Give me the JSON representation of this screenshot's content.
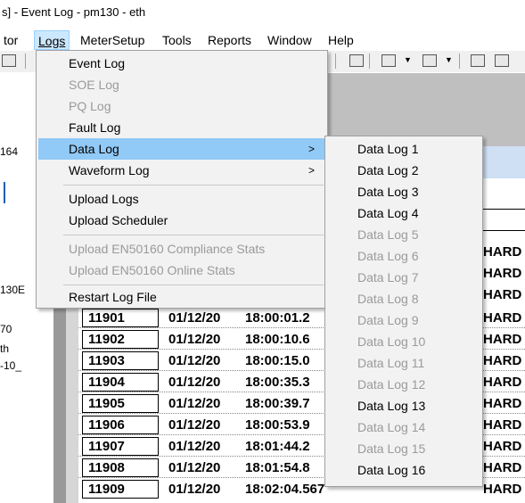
{
  "window": {
    "title": "s] - Event Log - pm130 - eth"
  },
  "menubar": {
    "items": [
      {
        "label": "tor"
      },
      {
        "label": "Logs",
        "active": true
      },
      {
        "label": "MeterSetup"
      },
      {
        "label": "Tools"
      },
      {
        "label": "Reports"
      },
      {
        "label": "Window"
      },
      {
        "label": "Help"
      }
    ]
  },
  "left_fragments": [
    "164",
    "130E",
    "70",
    "th",
    "-10_"
  ],
  "logs_menu": {
    "items": [
      {
        "label": "Event Log",
        "enabled": true
      },
      {
        "label": "SOE Log",
        "enabled": false
      },
      {
        "label": "PQ Log",
        "enabled": false
      },
      {
        "label": "Fault Log",
        "enabled": true
      },
      {
        "label": "Data Log",
        "enabled": true,
        "highlighted": true,
        "submenu": true
      },
      {
        "label": "Waveform Log",
        "enabled": true,
        "submenu": true
      },
      {
        "label": "Upload Logs",
        "enabled": true
      },
      {
        "label": "Upload Scheduler",
        "enabled": true
      },
      {
        "label": "Upload EN50160 Compliance Stats",
        "enabled": false
      },
      {
        "label": "Upload EN50160 Online Stats",
        "enabled": false
      },
      {
        "label": "Restart Log File",
        "enabled": true
      }
    ],
    "arrow_glyph": ">"
  },
  "data_log_submenu": {
    "items": [
      {
        "label": "Data Log 1",
        "enabled": true
      },
      {
        "label": "Data Log 2",
        "enabled": true
      },
      {
        "label": "Data Log 3",
        "enabled": true
      },
      {
        "label": "Data Log 4",
        "enabled": true
      },
      {
        "label": "Data Log 5",
        "enabled": false
      },
      {
        "label": "Data Log 6",
        "enabled": false
      },
      {
        "label": "Data Log 7",
        "enabled": false
      },
      {
        "label": "Data Log 8",
        "enabled": false
      },
      {
        "label": "Data Log 9",
        "enabled": false
      },
      {
        "label": "Data Log 10",
        "enabled": false
      },
      {
        "label": "Data Log 11",
        "enabled": false
      },
      {
        "label": "Data Log 12",
        "enabled": false
      },
      {
        "label": "Data Log 13",
        "enabled": true
      },
      {
        "label": "Data Log 14",
        "enabled": false
      },
      {
        "label": "Data Log 15",
        "enabled": false
      },
      {
        "label": "Data Log 16",
        "enabled": true
      }
    ]
  },
  "event_table": {
    "rows": [
      {
        "id": "11901",
        "date": "01/12/20",
        "time": "18:00:01.2"
      },
      {
        "id": "11902",
        "date": "01/12/20",
        "time": "18:00:10.6"
      },
      {
        "id": "11903",
        "date": "01/12/20",
        "time": "18:00:15.0"
      },
      {
        "id": "11904",
        "date": "01/12/20",
        "time": "18:00:35.3"
      },
      {
        "id": "11905",
        "date": "01/12/20",
        "time": "18:00:39.7"
      },
      {
        "id": "11906",
        "date": "01/12/20",
        "time": "18:00:53.9"
      },
      {
        "id": "11907",
        "date": "01/12/20",
        "time": "18:01:44.2"
      },
      {
        "id": "11908",
        "date": "01/12/20",
        "time": "18:01:54.8"
      },
      {
        "id": "11909",
        "date": "01/12/20",
        "time": "18:02:04.567"
      }
    ],
    "source_label": "HARD"
  },
  "toolbar": {
    "icons": [
      "print-icon",
      "grid-icon",
      "export-icon",
      "import-icon",
      "picture-icon",
      "chart-icon"
    ]
  }
}
